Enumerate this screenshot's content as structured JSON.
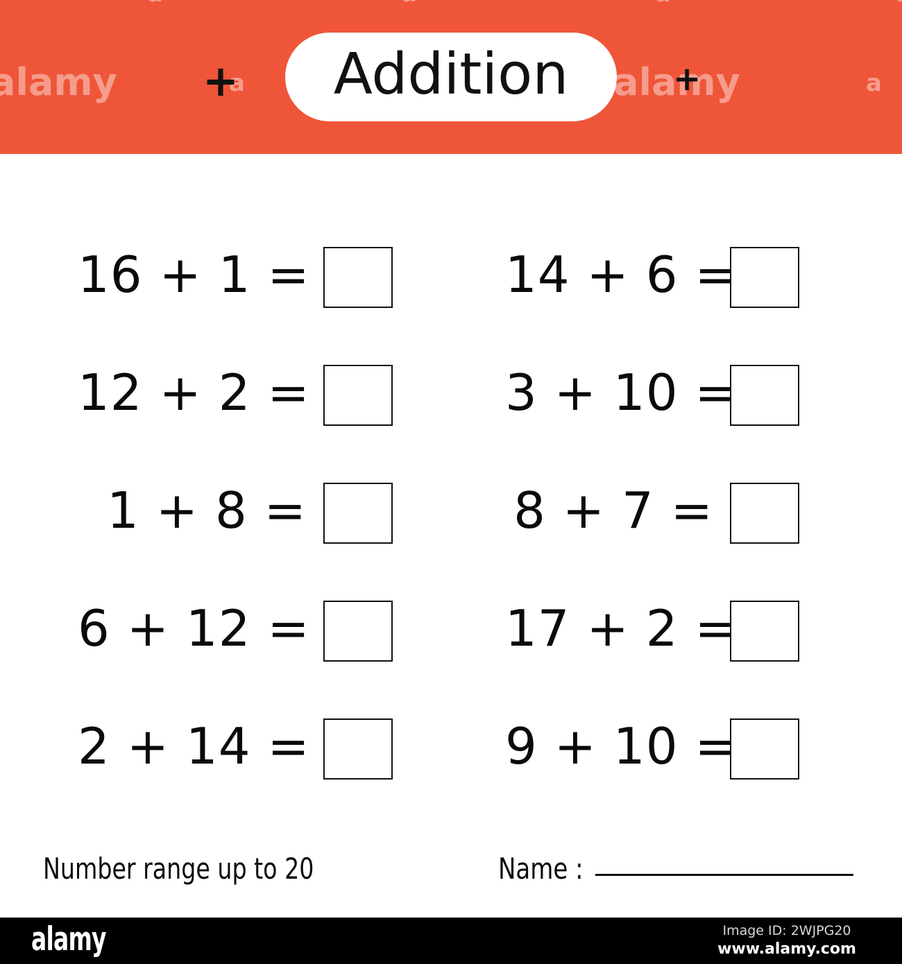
{
  "header": {
    "title": "Addition",
    "background_color": "#ef5539",
    "pill_color": "#ffffff",
    "plus_left": "+",
    "plus_right": "+",
    "watermarks": [
      "alamy",
      "a",
      "alamy",
      "a",
      "a",
      "a",
      "a",
      "a"
    ]
  },
  "worksheet": {
    "left_column": [
      {
        "expression": "16 + 1 =",
        "answer": ""
      },
      {
        "expression": "12 + 2 =",
        "answer": ""
      },
      {
        "expression": "1  + 8 =",
        "answer": ""
      },
      {
        "expression": "6 + 12 =",
        "answer": ""
      },
      {
        "expression": "2 + 14 =",
        "answer": ""
      }
    ],
    "right_column": [
      {
        "expression": "14 + 6 =",
        "answer": ""
      },
      {
        "expression": "3 + 10 =",
        "answer": ""
      },
      {
        "expression": "8 + 7 =",
        "answer": ""
      },
      {
        "expression": "17 + 2 =",
        "answer": ""
      },
      {
        "expression": "9 + 10 =",
        "answer": ""
      }
    ]
  },
  "footer": {
    "range_note": "Number range up to 20",
    "name_label": "Name :",
    "name_value": ""
  },
  "attribution": {
    "logo": "alamy",
    "image_id": "Image ID: 2WJPG20",
    "url": "www.alamy.com"
  }
}
